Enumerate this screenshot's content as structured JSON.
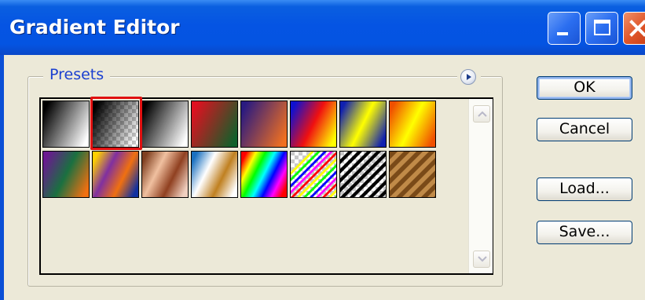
{
  "window": {
    "title": "Gradient Editor",
    "controls": [
      "minimize-icon",
      "maximize-icon",
      "close-icon"
    ]
  },
  "presets": {
    "label": "Presets",
    "menu_icon": "menu-arrow-icon",
    "selected_index": 1,
    "swatches": [
      {
        "name": "foreground-to-background",
        "colors": [
          "#000000",
          "#ffffff"
        ]
      },
      {
        "name": "foreground-to-transparent",
        "colors": [
          "#000000",
          "transparent"
        ]
      },
      {
        "name": "black-white",
        "colors": [
          "#000000",
          "#ffffff"
        ]
      },
      {
        "name": "red-green",
        "colors": [
          "#e01020",
          "#10602a"
        ]
      },
      {
        "name": "violet-orange",
        "colors": [
          "#2a1a80",
          "#f07020"
        ]
      },
      {
        "name": "blue-red-yellow",
        "colors": [
          "#1010d0",
          "#f01010",
          "#ffff00"
        ]
      },
      {
        "name": "blue-yellow-blue",
        "colors": [
          "#1020b0",
          "#ffff00",
          "#1020b0"
        ]
      },
      {
        "name": "orange-yellow-orange",
        "colors": [
          "#f05000",
          "#ffff00",
          "#f05000"
        ]
      },
      {
        "name": "violet-green-orange",
        "colors": [
          "#6a1a90",
          "#1a7040",
          "#f07010"
        ]
      },
      {
        "name": "yellow-violet-orange-blue",
        "colors": [
          "#ffd000",
          "#8030a0",
          "#f07010",
          "#1030a0"
        ]
      },
      {
        "name": "copper",
        "colors": [
          "#804020",
          "#f0c0a0",
          "#904020",
          "#f0d0c0"
        ]
      },
      {
        "name": "chrome",
        "colors": [
          "#1a70c0",
          "#ffffff",
          "#c08020",
          "#ffffff"
        ]
      },
      {
        "name": "spectrum",
        "colors": [
          "#ff0000",
          "#ffff00",
          "#00ff00",
          "#00ffff",
          "#0000ff",
          "#ff00ff",
          "#ff0000"
        ]
      },
      {
        "name": "transparent-rainbow",
        "colors": [
          "#ff0000",
          "#ffff00",
          "#00ff00",
          "#0000ff",
          "#ff00ff"
        ]
      },
      {
        "name": "transparent-stripes",
        "colors": [
          "#000000",
          "#ffffff"
        ]
      },
      {
        "name": "wood-stripes",
        "colors": [
          "#6a3a10",
          "#c08040"
        ]
      }
    ]
  },
  "buttons": {
    "ok": "OK",
    "cancel": "Cancel",
    "load": "Load...",
    "save": "Save..."
  },
  "colors": {
    "titlebar": "#0454e2",
    "dialog_bg": "#ece9d8",
    "group_label": "#1a3fd0",
    "selection": "#e01010"
  }
}
